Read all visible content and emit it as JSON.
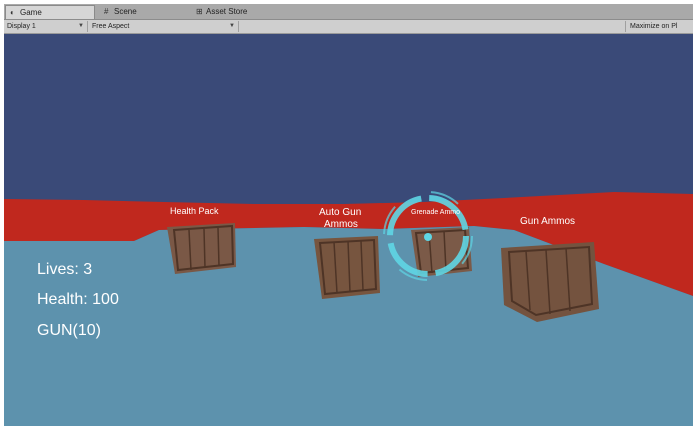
{
  "tabs": [
    {
      "label": "Game",
      "icon": "game-controller-icon",
      "active": true
    },
    {
      "label": "Scene",
      "icon": "scene-icon",
      "active": false
    },
    {
      "label": "Asset Store",
      "icon": "asset-store-icon",
      "active": false
    }
  ],
  "toolbar": {
    "display": "Display 1",
    "aspect": "Free Aspect",
    "maximize": "Maximize on Pl"
  },
  "hud": {
    "lives": "Lives: 3",
    "health": "Health: 100",
    "weapon": "GUN(10)"
  },
  "pickups": {
    "health_pack": "Health Pack",
    "auto_gun_line1": "Auto Gun",
    "auto_gun_line2": "Ammos",
    "grenade": "Grenade Ammo",
    "gun_ammo": "Gun Ammos"
  },
  "colors": {
    "sky": "#3a4a78",
    "floor": "#5d92ad",
    "wall": "#c0281e",
    "reticle": "#5fd6e4",
    "crate": "#6b4b3a"
  }
}
